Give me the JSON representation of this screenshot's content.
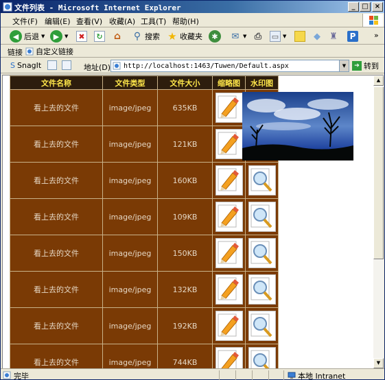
{
  "window": {
    "title": "文件列表 - Microsoft Internet Explorer",
    "controls": [
      "_",
      "□",
      "×"
    ]
  },
  "menu": {
    "items": [
      "文件(F)",
      "编辑(E)",
      "查看(V)",
      "收藏(A)",
      "工具(T)",
      "帮助(H)"
    ]
  },
  "toolbar": {
    "back_label": "后退",
    "search_label": "搜索",
    "favorites_label": "收藏夹",
    "overflow": "»"
  },
  "links": {
    "label": "链接",
    "item": "自定义链接"
  },
  "addressbar": {
    "snagit_label": "SnagIt",
    "address_label": "地址(D)",
    "url": "http://localhost:1463/Tuwen/Default.aspx",
    "go_label": "转到"
  },
  "table": {
    "headers": [
      "文件名称",
      "文件类型",
      "文件大小",
      "缩略图",
      "水印图"
    ],
    "rows": [
      {
        "name": "看上去的文件",
        "type": "image/jpeg",
        "size": "635KB"
      },
      {
        "name": "看上去的文件",
        "type": "image/jpeg",
        "size": "121KB"
      },
      {
        "name": "看上去的文件",
        "type": "image/jpeg",
        "size": "160KB"
      },
      {
        "name": "看上去的文件",
        "type": "image/jpeg",
        "size": "109KB"
      },
      {
        "name": "看上去的文件",
        "type": "image/jpeg",
        "size": "150KB"
      },
      {
        "name": "看上去的文件",
        "type": "image/jpeg",
        "size": "132KB"
      },
      {
        "name": "看上去的文件",
        "type": "image/jpeg",
        "size": "192KB"
      },
      {
        "name": "看上去的文件",
        "type": "image/jpeg",
        "size": "744KB"
      }
    ]
  },
  "status": {
    "text": "完毕",
    "zone": "本地 Intranet"
  },
  "colors": {
    "table_bg": "#7a3a05",
    "header_bg": "#2d1d0d",
    "header_text": "#ffe74a",
    "name_link": "#4d8ec5"
  }
}
